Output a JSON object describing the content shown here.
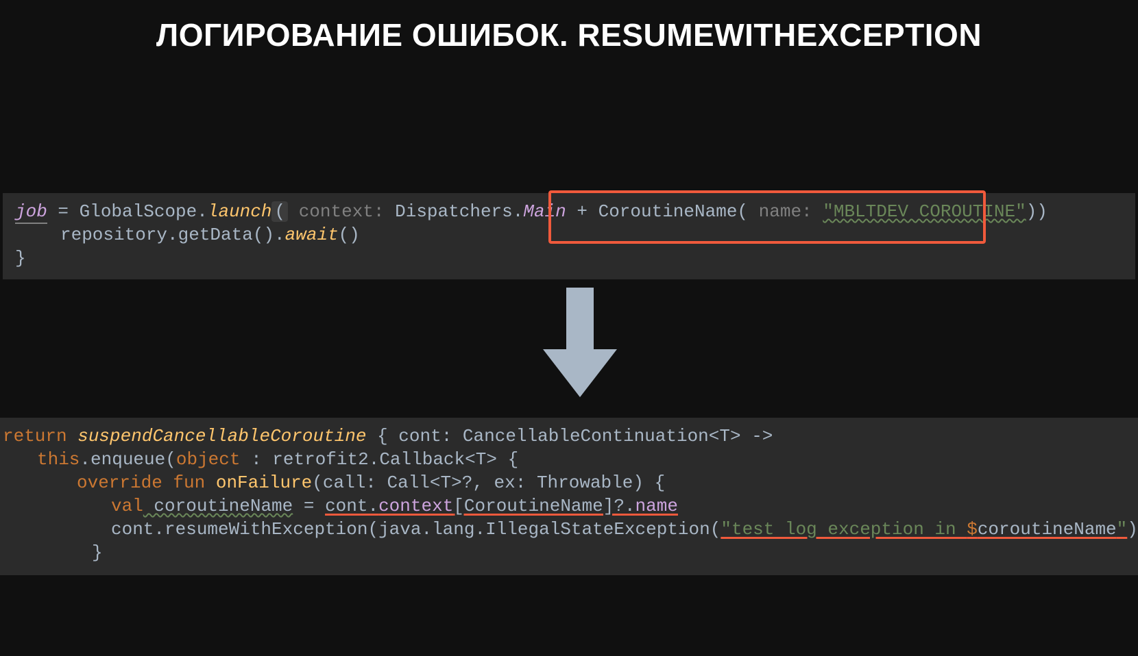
{
  "title": "ЛОГИРОВАНИЕ ОШИБОК. RESUMEWITHEXCEPTION",
  "block1": {
    "t1": "job",
    "t2": " = GlobalScope.",
    "t3": "launch",
    "t4": "(",
    "t5": " context: ",
    "t6": "Dispatchers.",
    "t7": "Main",
    "t8": " + ",
    "t9": "CoroutineName(",
    "t10": " name: ",
    "t11": "\"MBLTDEV COROUTINE\"",
    "t12": "))",
    "t13": "repository.getData().",
    "t14": "await",
    "t15": "()",
    "t16": "}"
  },
  "block2": {
    "r1a": "return",
    "r1b": " suspendCancellableCoroutine",
    "r1c": " { cont: CancellableContinuation<",
    "r1d": "T",
    "r1e": "> ->",
    "r2a": "this",
    "r2b": ".enqueue(",
    "r2c": "object",
    "r2d": " : retrofit2.Callback<",
    "r2e": "T",
    "r2f": "> {",
    "r3a": "override",
    "r3b": " fun",
    "r3c": " onFailure",
    "r3d": "(call: Call<",
    "r3e": "T",
    "r3f": ">?, ex: Throwable) {",
    "r4a": "val",
    "r4b": " coroutineName",
    "r4c": " = ",
    "r4d": "cont.",
    "r4e": "context",
    "r4f": "[CoroutineName]?.",
    "r4g": "name",
    "r5a": "cont.resumeWithException(java.lang.IllegalStateException(",
    "r5b": "\"test log exception in ",
    "r5c": "$",
    "r5d": "coroutineName",
    "r5e": "\"",
    "r5f": "))",
    "r6": "}"
  }
}
